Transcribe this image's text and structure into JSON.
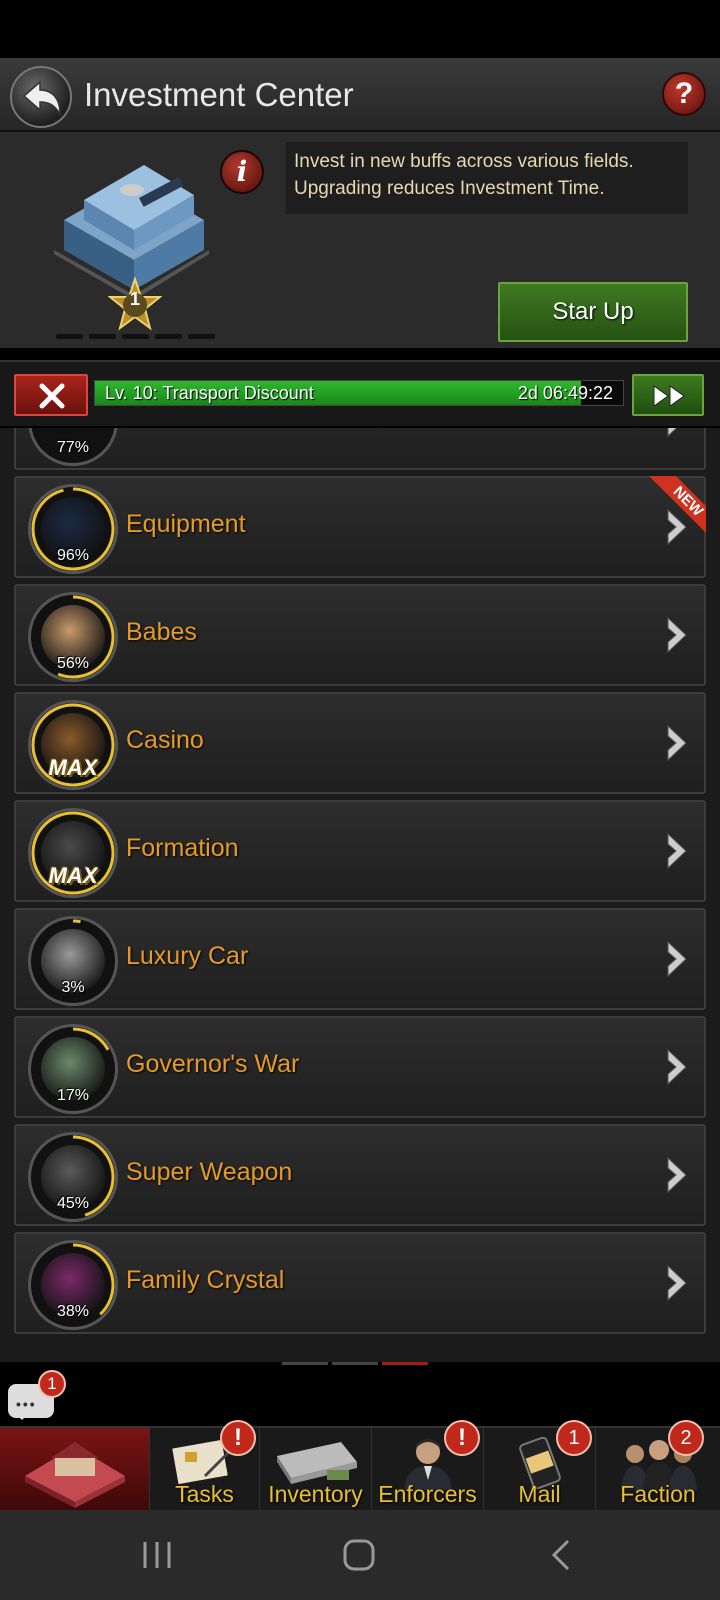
{
  "header": {
    "title": "Investment Center",
    "help_label": "?"
  },
  "info": {
    "description": "Invest in new buffs across various fields. Upgrading reduces Investment Time.",
    "star_level": "1",
    "star_up_label": "Star Up",
    "info_label": "i"
  },
  "queue": {
    "label": "Lv. 10: Transport Discount",
    "time_remaining": "2d 06:49:22",
    "progress_fraction": 0.92
  },
  "list": {
    "partial_item": {
      "percent": "77%"
    },
    "items": [
      {
        "name": "Equipment",
        "percent": "96%",
        "new": true,
        "new_label": "NEW",
        "progress": 0.96,
        "color": "#1b2a44"
      },
      {
        "name": "Babes",
        "percent": "56%",
        "new": false,
        "progress": 0.56,
        "color": "#c89a6a"
      },
      {
        "name": "Casino",
        "percent": "MAX",
        "max": true,
        "progress": 1.0,
        "color": "#8a5a2a"
      },
      {
        "name": "Formation",
        "percent": "MAX",
        "max": true,
        "progress": 1.0,
        "color": "#4a4a4a"
      },
      {
        "name": "Luxury Car",
        "percent": "3%",
        "progress": 0.03,
        "color": "#9a9a9a"
      },
      {
        "name": "Governor's War",
        "percent": "17%",
        "progress": 0.17,
        "color": "#6a8a6a"
      },
      {
        "name": "Super Weapon",
        "percent": "45%",
        "progress": 0.45,
        "color": "#5a5a5a"
      },
      {
        "name": "Family Crystal",
        "percent": "38%",
        "progress": 0.38,
        "color": "#7a2a6a"
      }
    ]
  },
  "chat": {
    "badge": "1"
  },
  "nav": {
    "tasks": {
      "label": "Tasks",
      "badge": "!"
    },
    "inventory": {
      "label": "Inventory"
    },
    "enforcers": {
      "label": "Enforcers",
      "badge": "!"
    },
    "mail": {
      "label": "Mail",
      "badge": "1"
    },
    "faction": {
      "label": "Faction",
      "badge": "2"
    }
  },
  "colors": {
    "accent_orange": "#e69a28",
    "progress_green": "#2fb82f",
    "ring_gold": "#e8c030",
    "alert_red": "#c0281b"
  }
}
